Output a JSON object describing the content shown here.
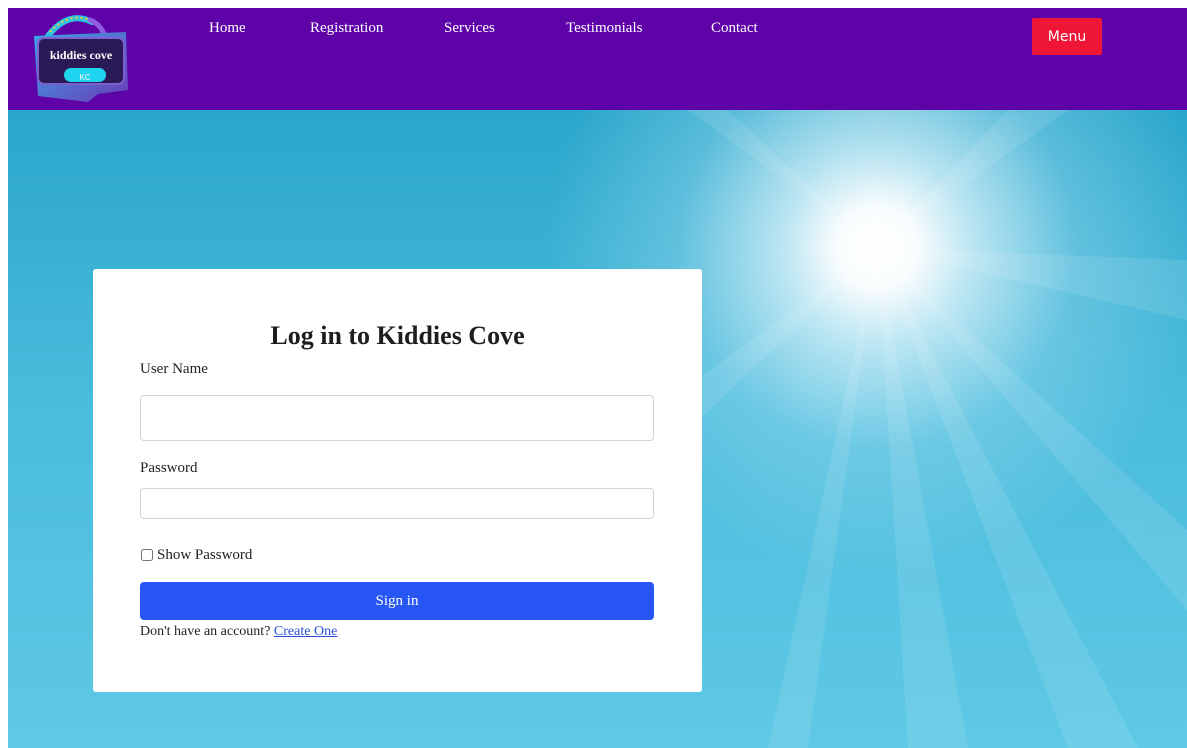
{
  "brand": {
    "name": "kiddies cove",
    "initials": "KC"
  },
  "nav": {
    "links": [
      {
        "label": "Home"
      },
      {
        "label": "Registration"
      },
      {
        "label": "Services"
      },
      {
        "label": "Testimonials"
      },
      {
        "label": "Contact"
      }
    ],
    "menu_label": "Menu"
  },
  "login": {
    "title": "Log in to Kiddies Cove",
    "username_label": "User Name",
    "username_value": "",
    "password_label": "Password",
    "password_value": "",
    "show_password_label": "Show Password",
    "show_password_checked": false,
    "signin_label": "Sign in",
    "no_account_text": "Don't have an account?",
    "create_link_label": "Create One"
  },
  "colors": {
    "navbar": "#5d03a8",
    "menu_button": "#ee1537",
    "signin_button": "#2756f5",
    "link": "#2a4fd6",
    "logo_ticket": "#1fd4ef",
    "logo_frame": "#6b3fb6"
  }
}
